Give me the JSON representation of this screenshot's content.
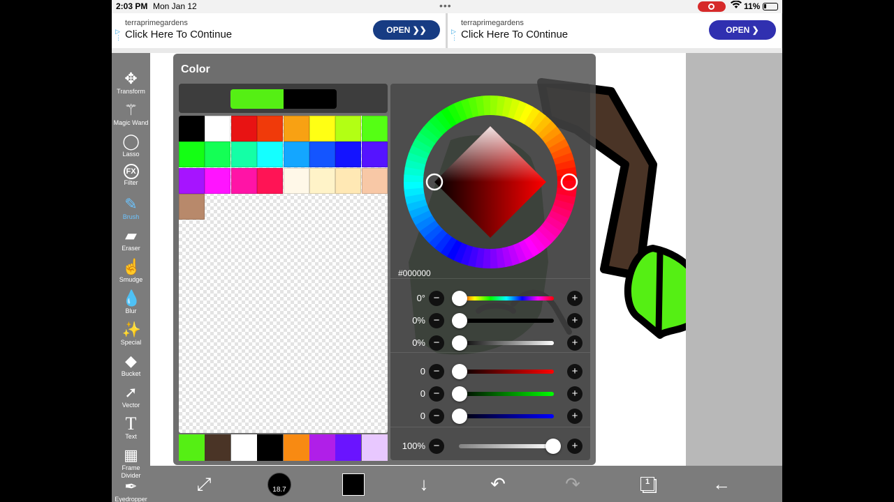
{
  "status_bar": {
    "time": "2:03 PM",
    "date": "Mon Jan 12",
    "battery": "11%"
  },
  "ads": [
    {
      "sponsor": "terraprimegardens",
      "title": "Click Here To C0ntinue",
      "button": "OPEN ❯❯"
    },
    {
      "sponsor": "terraprimegardens",
      "title": "Click Here To C0ntinue",
      "button": "OPEN ❯"
    }
  ],
  "tools": [
    {
      "label": "Transform",
      "icon": "move-arrows-icon",
      "glyph": "✥"
    },
    {
      "label": "Magic Wand",
      "icon": "magic-wand-icon",
      "glyph": "⚚"
    },
    {
      "label": "Lasso",
      "icon": "lasso-icon",
      "glyph": "◯"
    },
    {
      "label": "Filter",
      "icon": "fx-icon",
      "glyph": "FX"
    },
    {
      "label": "Brush",
      "icon": "brush-icon",
      "glyph": "✎",
      "active": true
    },
    {
      "label": "Eraser",
      "icon": "eraser-icon",
      "glyph": "▰"
    },
    {
      "label": "Smudge",
      "icon": "smudge-icon",
      "glyph": "☝"
    },
    {
      "label": "Blur",
      "icon": "droplet-icon",
      "glyph": "💧"
    },
    {
      "label": "Special",
      "icon": "sparkle-wand-icon",
      "glyph": "✨"
    },
    {
      "label": "Bucket",
      "icon": "bucket-icon",
      "glyph": "◆"
    },
    {
      "label": "Vector",
      "icon": "cursor-arrow-icon",
      "glyph": "➚"
    },
    {
      "label": "Text",
      "icon": "text-icon",
      "glyph": "T"
    },
    {
      "label": "Frame Divider",
      "icon": "frame-divider-icon",
      "glyph": "▦"
    },
    {
      "label": "Eyedropper",
      "icon": "eyedropper-icon",
      "glyph": "✒"
    }
  ],
  "color_panel": {
    "title": "Color",
    "current_colors": [
      "#55ef14",
      "#000000"
    ],
    "hex": "#000000",
    "palette": [
      "#000000",
      "#ffffff",
      "#e81313",
      "#f03a0a",
      "#f8a113",
      "#ffff14",
      "#b3ff14",
      "#55ff14",
      "#14ff14",
      "#14ff55",
      "#14ffa6",
      "#14ffff",
      "#14a6ff",
      "#1455ff",
      "#1414ff",
      "#5514ff",
      "#a614ff",
      "#ff14ff",
      "#ff14a6",
      "#ff1455",
      "#fff8e8",
      "#fff3c8",
      "#ffe8b4",
      "#f8c8a6",
      "#b8896b"
    ],
    "history": [
      "#55ef14",
      "#4a3426",
      "#ffffff",
      "#000000",
      "#f88a12",
      "#b01fe8",
      "#6a14ff",
      "#e8c8ff"
    ],
    "hsb": [
      {
        "value": "0°",
        "name": "hue"
      },
      {
        "value": "0%",
        "name": "saturation"
      },
      {
        "value": "0%",
        "name": "brightness"
      }
    ],
    "rgb": [
      {
        "value": "0",
        "name": "red"
      },
      {
        "value": "0",
        "name": "green"
      },
      {
        "value": "0",
        "name": "blue"
      }
    ],
    "opacity": {
      "value": "100%",
      "level": 1.0
    }
  },
  "bottom_bar": {
    "brush_size": "18.7",
    "layer_count": "1"
  }
}
